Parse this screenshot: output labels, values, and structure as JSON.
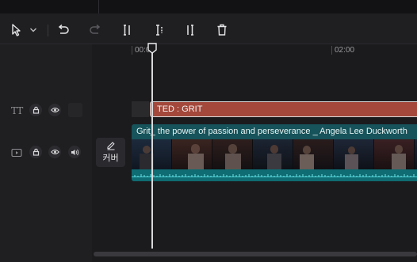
{
  "toolbar": {
    "icons": [
      "cursor-select-icon",
      "chevron-down-icon",
      "undo-icon",
      "redo-icon",
      "trim-left-icon",
      "split-icon",
      "trim-right-icon",
      "delete-icon"
    ]
  },
  "ruler": {
    "labels": [
      "00:00",
      "02:00"
    ]
  },
  "tracks": {
    "text_track": {
      "label": "TT",
      "clip_title": "TED : GRIT"
    },
    "video_track": {
      "cover_label": "커버",
      "clip_title": "Grit_ the power of passion and perseverance _ Angela Lee Duckworth"
    }
  },
  "colors": {
    "text_clip": "#a3483b",
    "video_clip": "#16535a",
    "wave": "#0f6c72",
    "playhead": "#d9d9dc"
  }
}
